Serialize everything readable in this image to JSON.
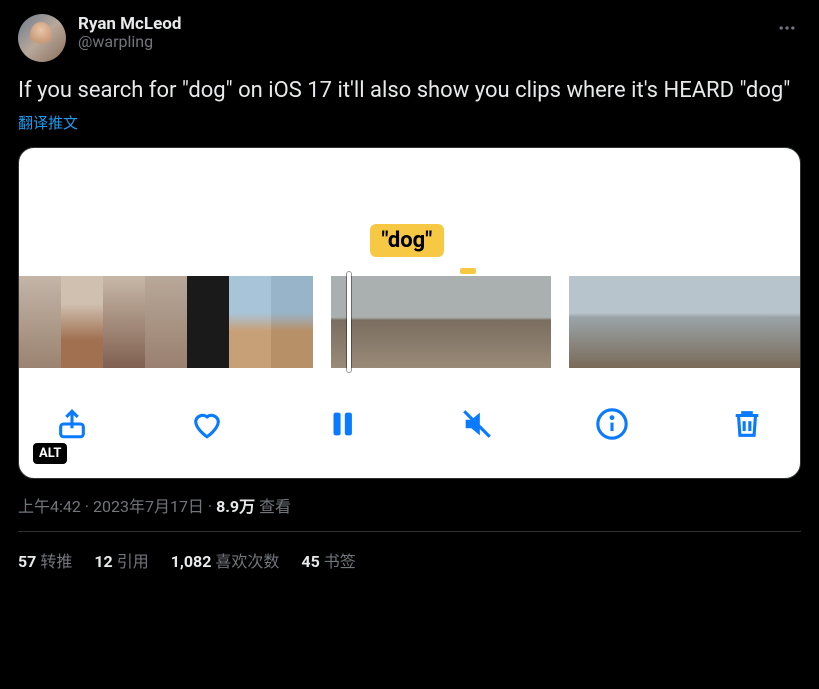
{
  "author": {
    "display_name": "Ryan McLeod",
    "handle": "@warpling"
  },
  "tweet_text": "If you search for \"dog\" on iOS 17 it'll also show you clips where it's HEARD \"dog\"",
  "translate_label": "翻译推文",
  "media": {
    "caption_label": "\"dog\"",
    "alt_badge": "ALT"
  },
  "meta": {
    "time": "上午4:42",
    "dot1": " · ",
    "date": "2023年7月17日",
    "dot2": " · ",
    "views_count": "8.9万",
    "views_label": " 查看"
  },
  "stats": {
    "retweets_n": "57",
    "retweets_label": "转推",
    "quotes_n": "12",
    "quotes_label": "引用",
    "likes_n": "1,082",
    "likes_label": "喜欢次数",
    "bookmarks_n": "45",
    "bookmarks_label": "书签"
  }
}
